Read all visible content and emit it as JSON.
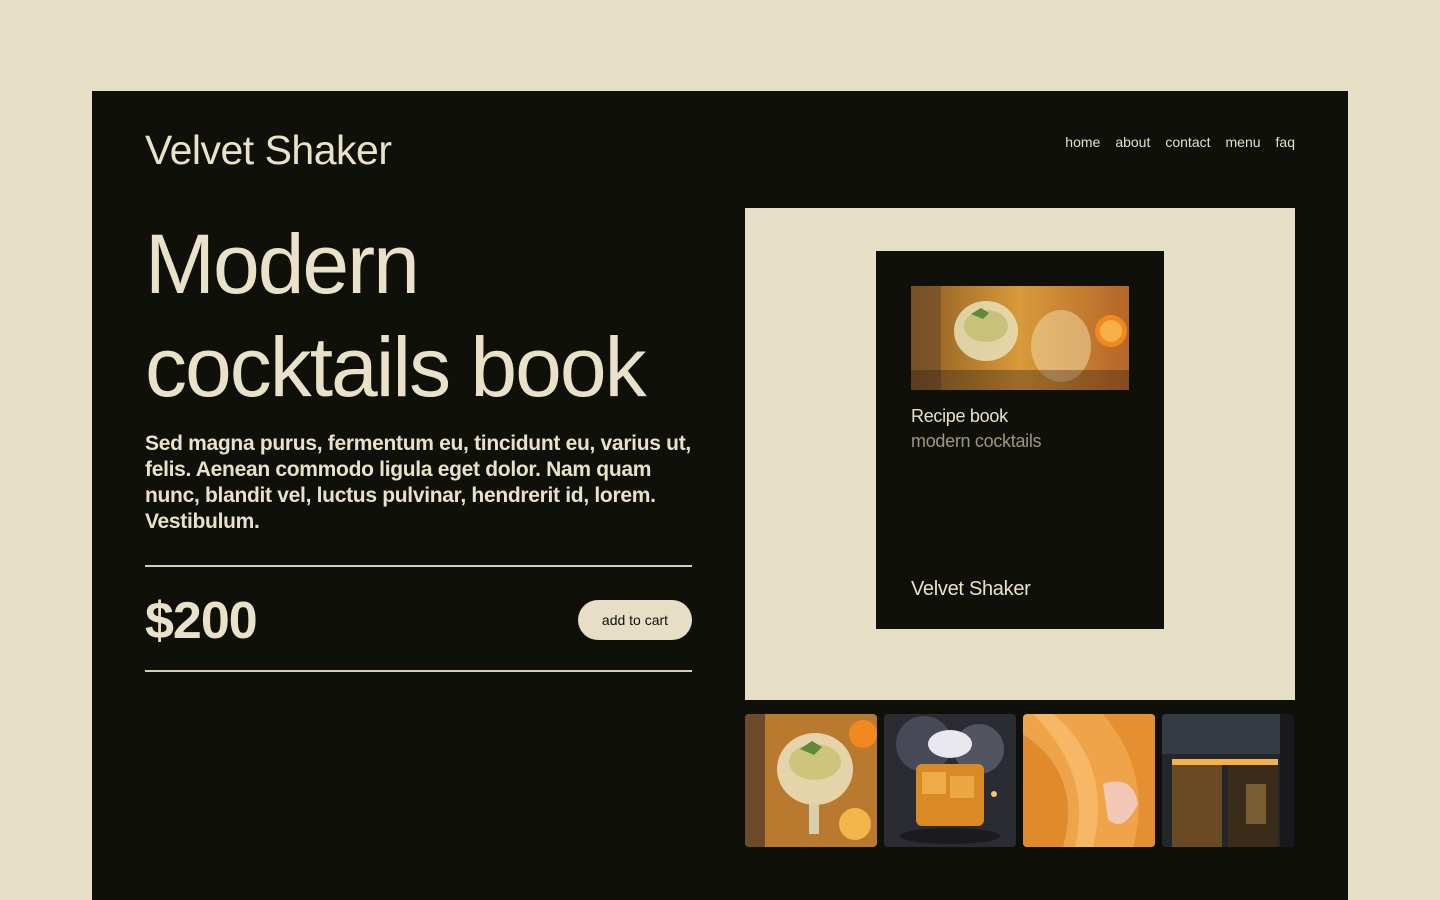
{
  "brand": {
    "name": "Velvet Shaker"
  },
  "nav": {
    "items": [
      "home",
      "about",
      "contact",
      "menu",
      "faq"
    ]
  },
  "hero": {
    "title": "Modern cocktails book",
    "description": "Sed magna purus, fermentum eu, tincidunt eu, varius ut, felis. Aenean commodo ligula eget dolor. Nam quam nunc, blandit vel, luctus pulvinar, hendrerit id, lorem. Vestibulum."
  },
  "product": {
    "price": "$200",
    "add_to_cart_label": "add to cart"
  },
  "book": {
    "title": "Recipe book",
    "subtitle": "modern cocktails",
    "brand": "Velvet Shaker"
  },
  "thumbnails": [
    "cocktail-glasses-photo",
    "smoked-whiskey-photo",
    "orange-petals-photo",
    "bar-storefront-photo"
  ],
  "colors": {
    "background": "#e6dfc6",
    "panel": "#10100b",
    "text": "#e9e2c8",
    "muted": "#9c9782"
  }
}
